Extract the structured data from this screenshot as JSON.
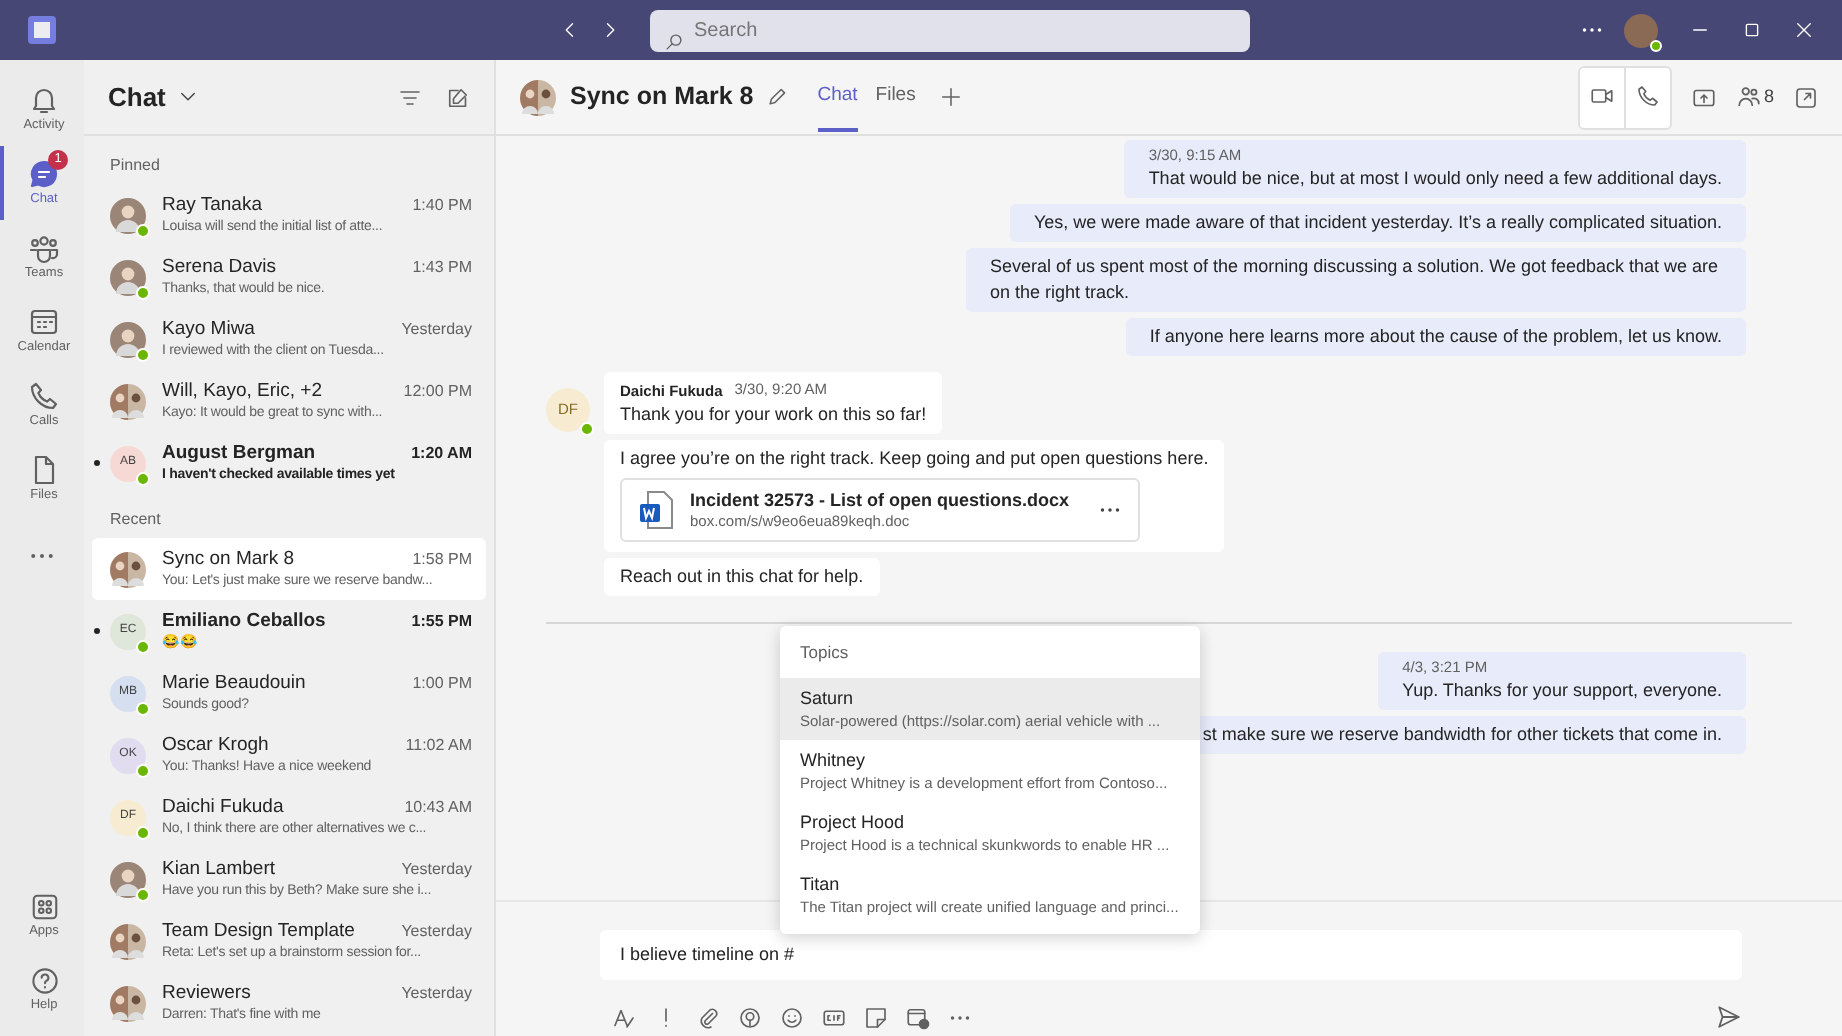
{
  "title_bar": {
    "search_placeholder": "Search"
  },
  "rail": [
    {
      "label": "Activity",
      "selected": false
    },
    {
      "label": "Chat",
      "selected": true,
      "badge": "1"
    },
    {
      "label": "Teams",
      "selected": false
    },
    {
      "label": "Calendar",
      "selected": false
    },
    {
      "label": "Calls",
      "selected": false
    },
    {
      "label": "Files",
      "selected": false
    }
  ],
  "rail_bottom": [
    {
      "label": "Apps"
    },
    {
      "label": "Help"
    }
  ],
  "chat_list": {
    "title": "Chat",
    "sections": [
      {
        "label": "Pinned",
        "items": [
          {
            "name": "Ray Tanaka",
            "time": "1:40 PM",
            "preview": "Louisa will send the initial list of atte...",
            "avatar": {
              "kind": "photo"
            },
            "unread": false,
            "selected": false
          },
          {
            "name": "Serena Davis",
            "time": "1:43 PM",
            "preview": "Thanks, that would be nice.",
            "avatar": {
              "kind": "photo"
            },
            "unread": false,
            "selected": false
          },
          {
            "name": "Kayo Miwa",
            "time": "Yesterday",
            "preview": "I reviewed with the client on Tuesda...",
            "avatar": {
              "kind": "photo"
            },
            "unread": false,
            "selected": false
          },
          {
            "name": "Will, Kayo, Eric, +2",
            "time": "12:00 PM",
            "preview": "Kayo: It would be great to sync with...",
            "avatar": {
              "kind": "group"
            },
            "unread": false,
            "selected": false
          },
          {
            "name": "August Bergman",
            "time": "1:20 AM",
            "preview": "I haven't checked available times yet",
            "avatar": {
              "kind": "initials",
              "initials": "AB",
              "color": "#f6d9d5"
            },
            "unread": true,
            "selected": false
          }
        ]
      },
      {
        "label": "Recent",
        "items": [
          {
            "name": "Sync on Mark 8",
            "time": "1:58 PM",
            "preview": "You: Let's just make sure we reserve bandw...",
            "avatar": {
              "kind": "group"
            },
            "unread": false,
            "selected": true
          },
          {
            "name": "Emiliano Ceballos",
            "time": "1:55 PM",
            "preview": "😂😂",
            "avatar": {
              "kind": "initials",
              "initials": "EC",
              "color": "#dfe6da"
            },
            "unread": true,
            "selected": false
          },
          {
            "name": "Marie Beaudouin",
            "time": "1:00 PM",
            "preview": "Sounds good?",
            "avatar": {
              "kind": "initials",
              "initials": "MB",
              "color": "#d5dff0"
            },
            "unread": false,
            "selected": false
          },
          {
            "name": "Oscar Krogh",
            "time": "11:02 AM",
            "preview": "You: Thanks! Have a nice weekend",
            "avatar": {
              "kind": "initials",
              "initials": "OK",
              "color": "#e1dcf0"
            },
            "unread": false,
            "selected": false
          },
          {
            "name": "Daichi Fukuda",
            "time": "10:43 AM",
            "preview": "No, I think there are other alternatives we c...",
            "avatar": {
              "kind": "initials",
              "initials": "DF",
              "color": "#f7ecd2"
            },
            "unread": false,
            "selected": false
          },
          {
            "name": "Kian Lambert",
            "time": "Yesterday",
            "preview": "Have you run this by Beth? Make sure she i...",
            "avatar": {
              "kind": "photo"
            },
            "unread": false,
            "selected": false
          },
          {
            "name": "Team Design Template",
            "time": "Yesterday",
            "preview": "Reta: Let's set up a brainstorm session for...",
            "avatar": {
              "kind": "group"
            },
            "unread": false,
            "selected": false
          },
          {
            "name": "Reviewers",
            "time": "Yesterday",
            "preview": "Darren: That's fine with me",
            "avatar": {
              "kind": "group"
            },
            "unread": false,
            "selected": false
          }
        ]
      }
    ]
  },
  "conversation": {
    "title": "Sync on Mark 8",
    "tabs": [
      {
        "label": "Chat",
        "selected": true
      },
      {
        "label": "Files",
        "selected": false
      }
    ],
    "participants_count": "8",
    "messages": [
      {
        "kind": "me",
        "time": "3/30, 9:15 AM",
        "text": "That would be nice, but at most I would only need a few additional days."
      },
      {
        "kind": "me",
        "text": "Yes, we were made aware of that incident yesterday. It’s a really complicated situation."
      },
      {
        "kind": "me",
        "text": "Several of us spent most of the morning discussing a solution. We got feedback that we are on the right track."
      },
      {
        "kind": "me",
        "text": "If anyone here learns more about the cause of the problem, let us know."
      },
      {
        "kind": "other",
        "sender": "Daichi Fukuda",
        "initials": "DF",
        "time": "3/30, 9:20 AM",
        "text": "Thank you for your work on this so far!"
      },
      {
        "kind": "other",
        "text": "I agree you’re on the right track. Keep going and put open questions here.",
        "attachment": {
          "name": "Incident 32573 - List of open questions.docx",
          "url": "box.com/s/w9eo6eua89keqh.doc"
        }
      },
      {
        "kind": "other",
        "text": "Reach out in this chat for help."
      },
      {
        "kind": "divider"
      },
      {
        "kind": "me",
        "time": "4/3, 3:21 PM",
        "text": "Yup. Thanks for your support, everyone."
      },
      {
        "kind": "me",
        "text": "st make sure we reserve bandwidth for other tickets that come in."
      }
    ],
    "topics": {
      "heading": "Topics",
      "items": [
        {
          "name": "Saturn",
          "description": "Solar-powered (https://solar.com) aerial vehicle with ...",
          "selected": true
        },
        {
          "name": "Whitney",
          "description": "Project Whitney is a development effort from Contoso...",
          "selected": false
        },
        {
          "name": "Project Hood",
          "description": "Project Hood is a technical skunkwords to enable HR ...",
          "selected": false
        },
        {
          "name": "Titan",
          "description": "The Titan project will create unified language and princi...",
          "selected": false
        }
      ]
    },
    "compose": {
      "value": "I believe timeline on #"
    }
  }
}
